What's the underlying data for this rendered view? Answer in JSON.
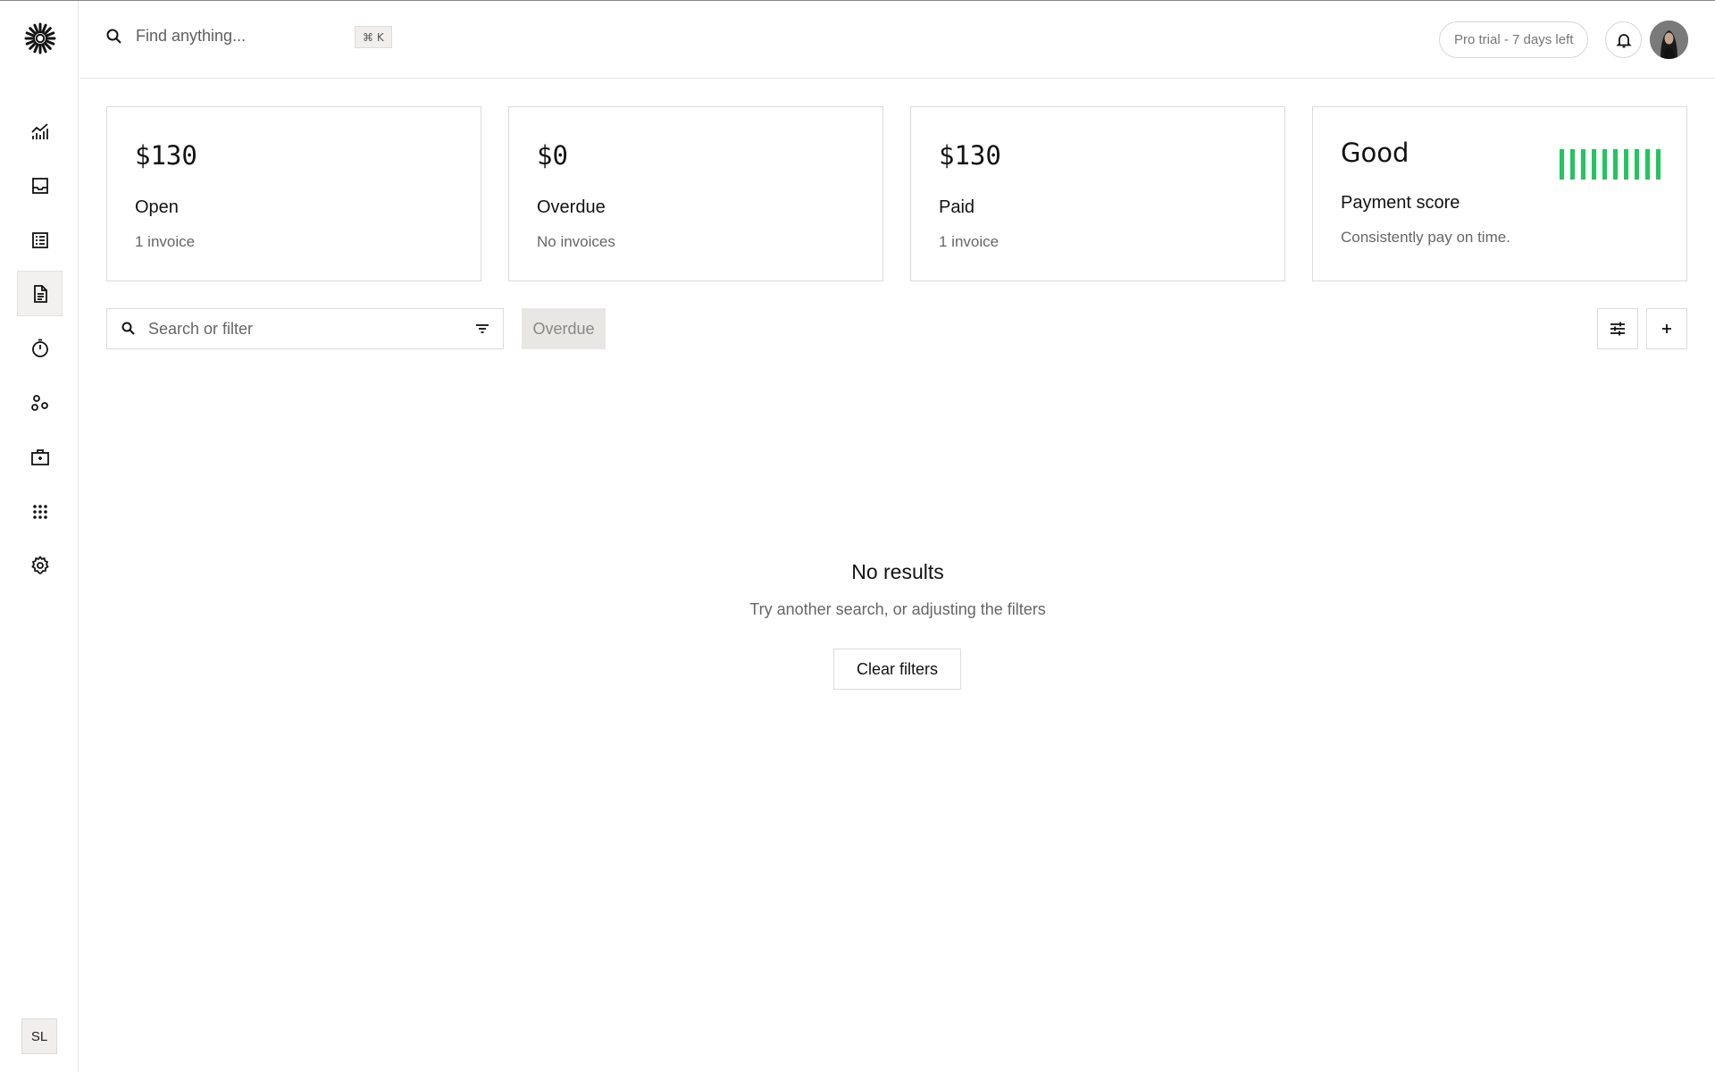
{
  "header": {
    "search_placeholder": "Find anything...",
    "shortcut": "⌘ K",
    "trial_label": "Pro trial - 7 days left"
  },
  "sidebar": {
    "items": [
      {
        "icon": "chart-icon"
      },
      {
        "icon": "inbox-icon"
      },
      {
        "icon": "transactions-icon"
      },
      {
        "icon": "invoice-icon",
        "active": true
      },
      {
        "icon": "timer-icon"
      },
      {
        "icon": "customers-icon"
      },
      {
        "icon": "vault-icon"
      },
      {
        "icon": "apps-icon"
      },
      {
        "icon": "settings-icon"
      }
    ],
    "user_initials": "SL"
  },
  "cards": [
    {
      "amount": "$130",
      "label": "Open",
      "sub": "1 invoice"
    },
    {
      "amount": "$0",
      "label": "Overdue",
      "sub": "No invoices"
    },
    {
      "amount": "$130",
      "label": "Paid",
      "sub": "1 invoice"
    },
    {
      "amount": "Good",
      "label": "Payment score",
      "sub": "Consistently pay on time.",
      "score_bars": 10,
      "score_color": "#22c55e"
    }
  ],
  "toolbar": {
    "search_placeholder": "Search or filter",
    "active_filter": "Overdue"
  },
  "empty_state": {
    "title": "No results",
    "subtitle": "Try another search, or adjusting the filters",
    "clear_label": "Clear filters"
  }
}
